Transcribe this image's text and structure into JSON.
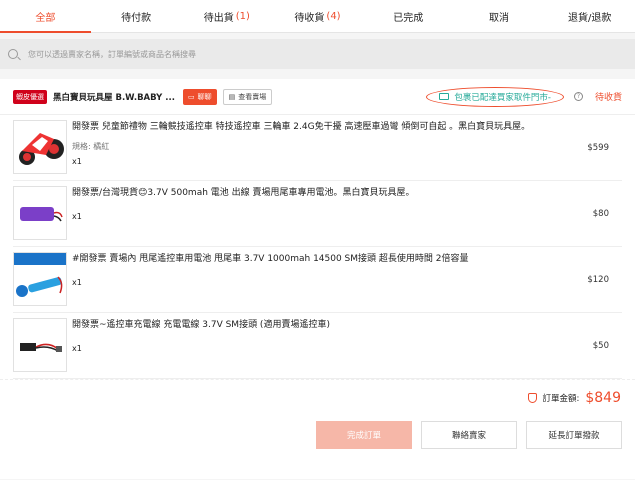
{
  "tabs": [
    {
      "label": "全部",
      "count": ""
    },
    {
      "label": "待付款",
      "count": ""
    },
    {
      "label": "待出貨",
      "count": "(1)"
    },
    {
      "label": "待收貨",
      "count": "(4)"
    },
    {
      "label": "已完成",
      "count": ""
    },
    {
      "label": "取消",
      "count": ""
    },
    {
      "label": "退貨/退款",
      "count": ""
    }
  ],
  "search": {
    "placeholder": "您可以透過賣家名稱，訂單編號或商品名稱搜尋"
  },
  "shop": {
    "badge": "蝦皮優選",
    "name": "黑白寶貝玩具屋 B.W.BABY ...",
    "chat_label": "聊聊",
    "view_label": "查看賣場",
    "shipping_status": "包裹已配達買家取件門市-",
    "order_status": "待收貨"
  },
  "items": [
    {
      "title": "開發票 兒童節禮物 三輪競技遙控車 特技遙控車 三輪車 2.4G免干擾 高速壓車過彎 傾倒可自起 。黑白寶貝玩具屋。",
      "variant": "規格: 橘紅",
      "qty": "x1",
      "price": "$599"
    },
    {
      "title": "開發票/台灣現貨😊3.7V 500mah 電池 出線 賣場甩尾車專用電池。黑白寶貝玩具屋。",
      "variant": "",
      "qty": "x1",
      "price": "$80"
    },
    {
      "title": "#開發票 賣場內 甩尾遙控車用電池 甩尾車 3.7V 1000mah 14500 SM接頭 超長使用時間 2倍容量",
      "variant": "",
      "qty": "x1",
      "price": "$120"
    },
    {
      "title": "開發票~遙控車充電線 充電電線 3.7V SM接頭 (適用賣場遙控車)",
      "variant": "",
      "qty": "x1",
      "price": "$50"
    }
  ],
  "total": {
    "label": "訂單金額:",
    "value": "$849"
  },
  "actions": {
    "complete": "完成訂單",
    "contact": "聯絡賣家",
    "extend": "延長訂單撥款"
  },
  "colors": {
    "accent": "#ee4d2d",
    "shipping": "#26aa99"
  }
}
